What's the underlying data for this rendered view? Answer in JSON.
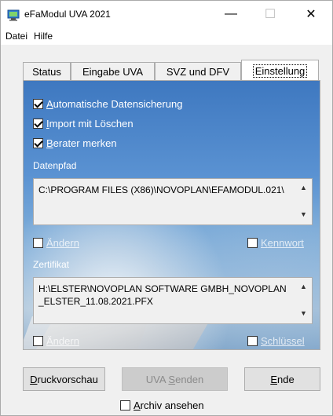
{
  "window": {
    "title": "eFaModul UVA 2021",
    "minimize_glyph": "—",
    "maximize_glyph": "☐",
    "close_glyph": "✕"
  },
  "menu": [
    "Datei",
    "Hilfe"
  ],
  "tabs": [
    {
      "label": "Status",
      "active": false
    },
    {
      "label": "Eingabe UVA",
      "active": false
    },
    {
      "label": "SVZ und DFV",
      "active": false
    },
    {
      "label": "Einstellung",
      "active": true
    }
  ],
  "settings": {
    "checkboxes": [
      {
        "mnemonic": "A",
        "rest": "utomatische Datensicherung",
        "checked": true
      },
      {
        "mnemonic": "I",
        "rest": "mport mit Löschen",
        "checked": true
      },
      {
        "mnemonic": "B",
        "rest": "erater merken",
        "checked": true
      }
    ],
    "datenpfad": {
      "label": "Datenpfad",
      "value": "C:\\PROGRAM FILES (X86)\\NOVOPLAN\\EFAMODUL.021\\",
      "change_mnemonic": "Ä",
      "change_rest": "ndern",
      "change_checked": false,
      "password_mnemonic": "K",
      "password_rest": "ennwort",
      "password_checked": false
    },
    "zertifikat": {
      "label": "Zertifikat",
      "value": "H:\\ELSTER\\NOVOPLAN SOFTWARE GMBH_NOVOPLAN_ELSTER_11.08.2021.PFX",
      "change_mnemonic": "Ä",
      "change_rest": "ndern",
      "change_checked": false,
      "key_mnemonic": "S",
      "key_rest": "chlüssel",
      "key_checked": false
    }
  },
  "buttons": {
    "preview_mnemonic": "D",
    "preview_rest": "ruckvorschau",
    "send_prefix": "UVA ",
    "send_mnemonic": "S",
    "send_rest": "enden",
    "end_mnemonic": "E",
    "end_rest": "nde"
  },
  "archive": {
    "mnemonic": "A",
    "rest": "rchiv ansehen",
    "checked": false
  },
  "colors": {
    "panel_top": "#3e78c0",
    "panel_bottom": "#a8c3da",
    "disabled_button": "#cccccc"
  }
}
